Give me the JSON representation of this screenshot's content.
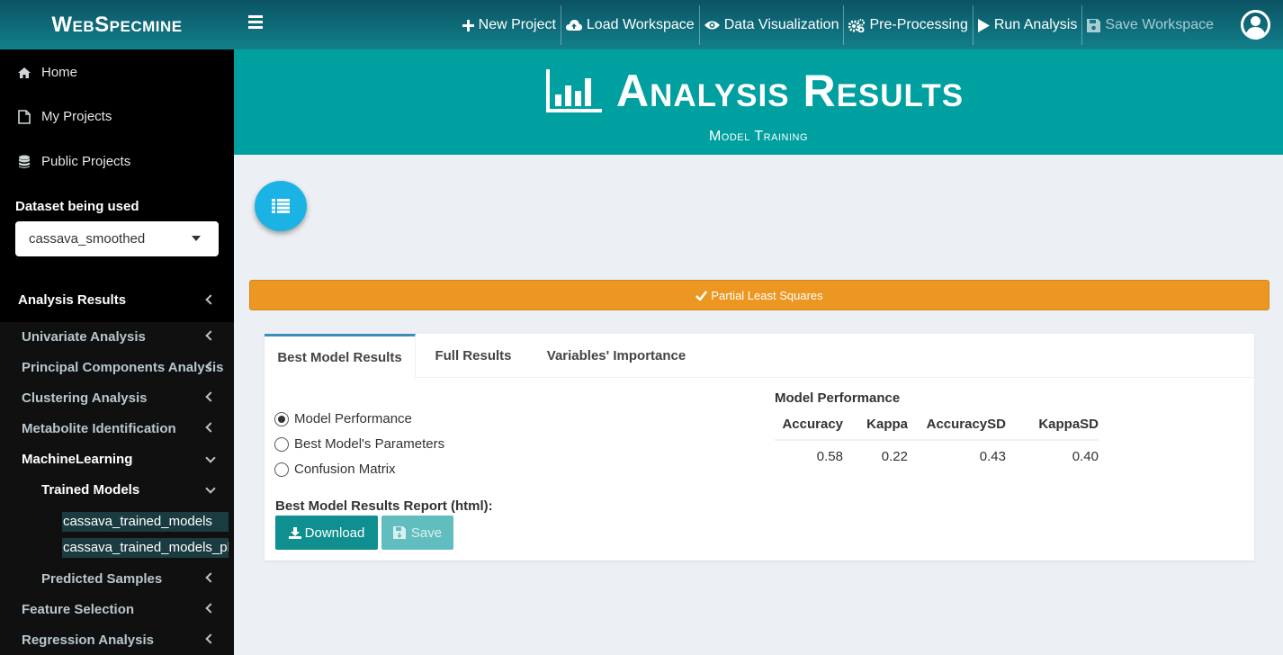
{
  "brand": "WebSpecmine",
  "topnav": [
    {
      "label": "New Project",
      "icon": "plus-icon",
      "disabled": false
    },
    {
      "label": "Load Workspace",
      "icon": "cloud-upload-icon",
      "disabled": false
    },
    {
      "label": "Data Visualization",
      "icon": "eye-icon",
      "disabled": false
    },
    {
      "label": "Pre-Processing",
      "icon": "cogs-icon",
      "disabled": false
    },
    {
      "label": "Run Analysis",
      "icon": "play-icon",
      "disabled": false
    },
    {
      "label": "Save Workspace",
      "icon": "floppy-icon",
      "disabled": true
    }
  ],
  "sidebar": {
    "links": [
      {
        "label": "Home",
        "icon": "home-icon"
      },
      {
        "label": "My Projects",
        "icon": "file-icon"
      },
      {
        "label": "Public Projects",
        "icon": "database-icon"
      }
    ],
    "dataset_label": "Dataset being used",
    "dataset_value": "cassava_smoothed",
    "section": "Analysis Results",
    "submenu": {
      "univariate": "Univariate Analysis",
      "pca": "Principal Components Analysis",
      "clustering": "Clustering Analysis",
      "metabolite": "Metabolite Identification",
      "ml": "MachineLearning",
      "trained": "Trained Models",
      "trained_items": [
        "cassava_trained_models",
        "cassava_trained_models_pls"
      ],
      "predicted": "Predicted Samples",
      "feature": "Feature Selection",
      "regression": "Regression Analysis"
    }
  },
  "header": {
    "title": "Analysis Results",
    "subtitle": "Model Training"
  },
  "model_bar": "Partial Least Squares",
  "tabs": [
    "Best Model Results",
    "Full Results",
    "Variables' Importance"
  ],
  "radios": [
    {
      "label": "Model Performance",
      "checked": true
    },
    {
      "label": "Best Model's Parameters",
      "checked": false
    },
    {
      "label": "Confusion Matrix",
      "checked": false
    }
  ],
  "report_label": "Best Model Results Report (html):",
  "download_label": "Download",
  "save_label": "Save",
  "performance": {
    "title": "Model Performance",
    "columns": [
      "Accuracy",
      "Kappa",
      "AccuracySD",
      "KappaSD"
    ],
    "values": [
      "0.58",
      "0.22",
      "0.43",
      "0.40"
    ]
  },
  "colors": {
    "header": "#00a0a0",
    "accent_bar": "#ec9721",
    "download": "#0f8f8f",
    "fab": "#1ab3e3"
  }
}
